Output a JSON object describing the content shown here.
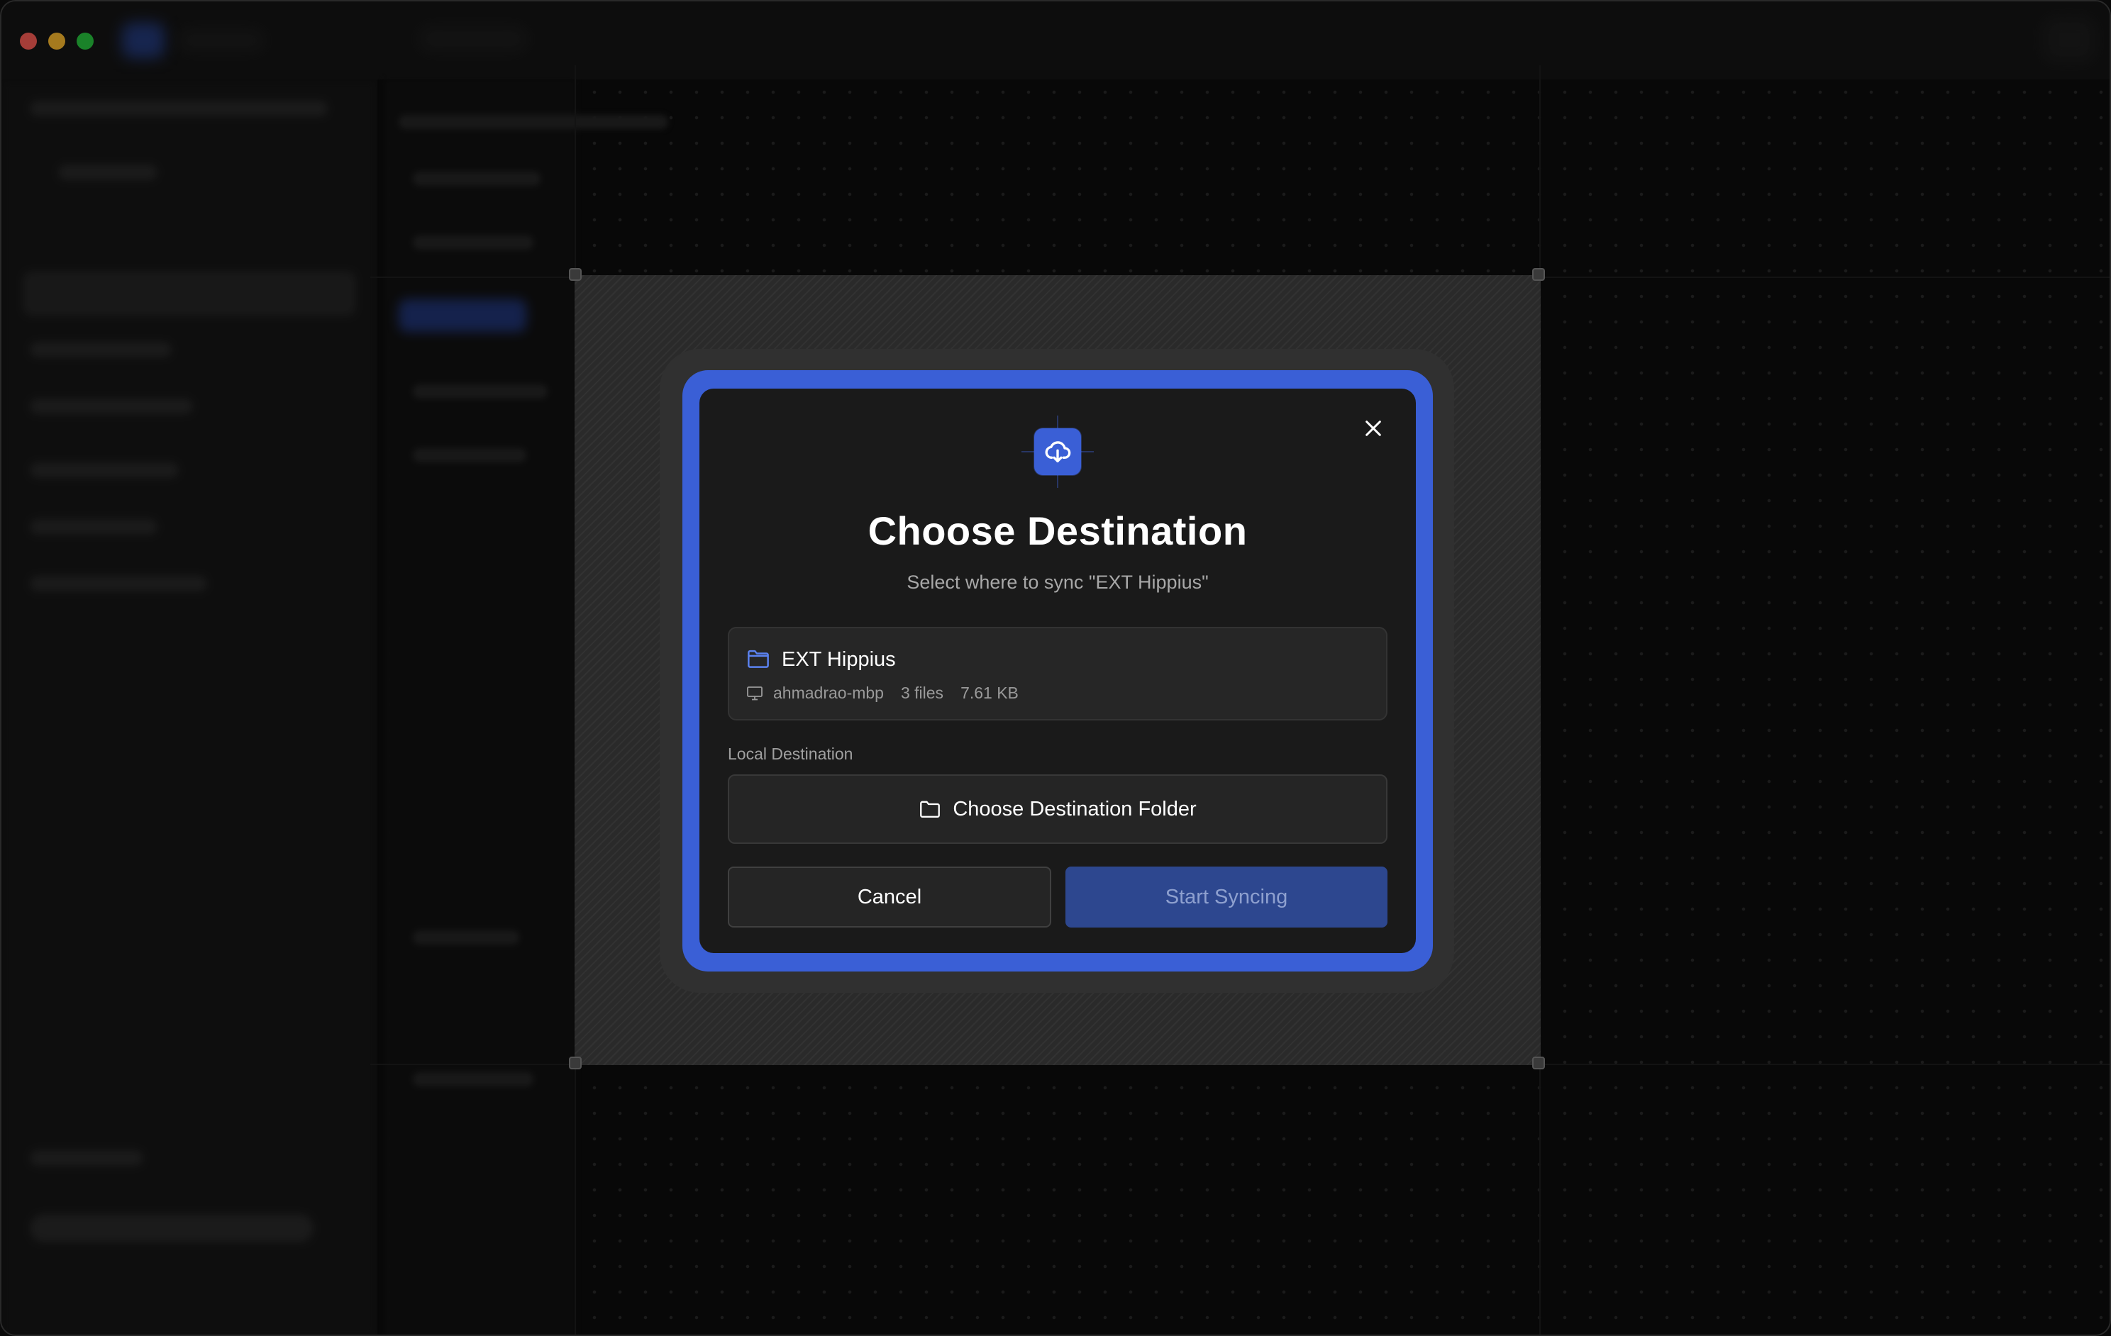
{
  "window": {
    "traffic_lights": [
      "close",
      "minimize",
      "zoom"
    ]
  },
  "dialog": {
    "icon": "cloud-download-icon",
    "title": "Choose Destination",
    "subtitle": "Select where to sync \"EXT Hippius\"",
    "close_icon": "close-icon",
    "source": {
      "icon": "folder-icon",
      "name": "EXT Hippius",
      "device_icon": "monitor-icon",
      "device": "ahmadrao-mbp",
      "files": "3 files",
      "size": "7.61 KB"
    },
    "destination_label": "Local Destination",
    "choose_folder_label": "Choose Destination Folder",
    "cancel_label": "Cancel",
    "start_label": "Start Syncing"
  },
  "colors": {
    "accent": "#3a5fd6",
    "dialog_bg": "#1a1a1a",
    "start_disabled": "#2d478f"
  }
}
